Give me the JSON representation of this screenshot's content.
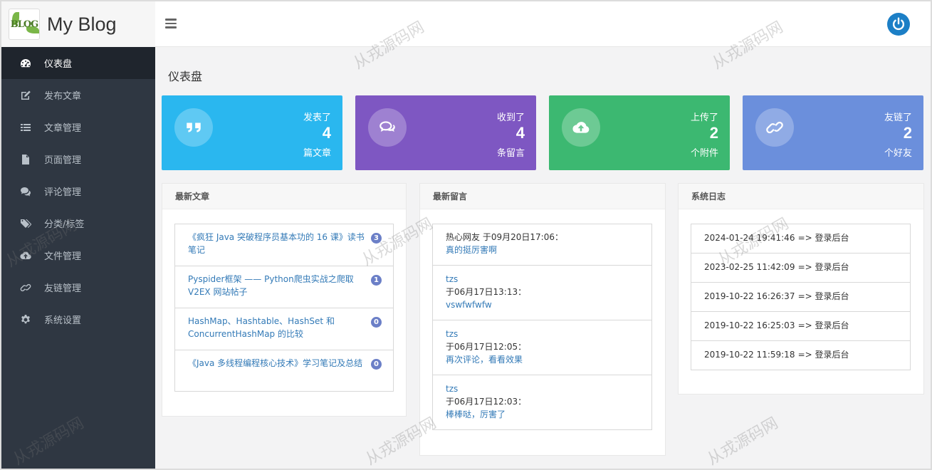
{
  "brand": {
    "logo_text": "BLOG",
    "title": "My Blog"
  },
  "sidebar": {
    "items": [
      {
        "label": "仪表盘",
        "icon": "dashboard-icon",
        "active": true
      },
      {
        "label": "发布文章",
        "icon": "edit-icon"
      },
      {
        "label": "文章管理",
        "icon": "list-icon"
      },
      {
        "label": "页面管理",
        "icon": "file-icon"
      },
      {
        "label": "评论管理",
        "icon": "comments-icon"
      },
      {
        "label": "分类/标签",
        "icon": "tags-icon"
      },
      {
        "label": "文件管理",
        "icon": "cloud-upload-icon"
      },
      {
        "label": "友链管理",
        "icon": "link-icon"
      },
      {
        "label": "系统设置",
        "icon": "gear-icon"
      }
    ]
  },
  "page": {
    "title": "仪表盘"
  },
  "stats": [
    {
      "top": "发表了",
      "count": "4",
      "bottom": "篇文章",
      "color": "#2ab7ef",
      "icon": "quote-icon"
    },
    {
      "top": "收到了",
      "count": "4",
      "bottom": "条留言",
      "color": "#7e57c2",
      "icon": "comments-icon"
    },
    {
      "top": "上传了",
      "count": "2",
      "bottom": "个附件",
      "color": "#3cb871",
      "icon": "cloud-upload-icon"
    },
    {
      "top": "友链了",
      "count": "2",
      "bottom": "个好友",
      "color": "#6b8fdc",
      "icon": "link-icon"
    }
  ],
  "articles": {
    "heading": "最新文章",
    "items": [
      {
        "title": "《疯狂 Java 突破程序员基本功的 16 课》读书笔记",
        "count": "3"
      },
      {
        "title": "Pyspider框架 —— Python爬虫实战之爬取 V2EX 网站帖子",
        "count": "1"
      },
      {
        "title": "HashMap、Hashtable、HashSet 和 ConcurrentHashMap 的比较",
        "count": "0"
      },
      {
        "title": "《Java 多线程编程核心技术》学习笔记及总结",
        "count": "0"
      }
    ]
  },
  "comments": {
    "heading": "最新留言",
    "items": [
      {
        "author": "热心网友",
        "time": "于09月20日17:06：",
        "content": "真的挺厉害啊",
        "inline": true
      },
      {
        "author": "tzs",
        "time": "于06月17日13:13：",
        "content": "vswfwfwfw"
      },
      {
        "author": "tzs",
        "time": "于06月17日12:05：",
        "content": "再次评论，看看效果"
      },
      {
        "author": "tzs",
        "time": "于06月17日12:03：",
        "content": "棒棒哒，厉害了"
      }
    ]
  },
  "logs": {
    "heading": "系统日志",
    "items": [
      {
        "time": "2024-01-24 19:41:46",
        "action": "=> 登录后台"
      },
      {
        "time": "2023-02-25 11:42:09",
        "action": "=> 登录后台"
      },
      {
        "time": "2019-10-22 16:26:37",
        "action": "=> 登录后台"
      },
      {
        "time": "2019-10-22 16:25:03",
        "action": "=> 登录后台"
      },
      {
        "time": "2019-10-22 11:59:18",
        "action": "=> 登录后台"
      }
    ]
  },
  "watermark": "从戎源码网"
}
